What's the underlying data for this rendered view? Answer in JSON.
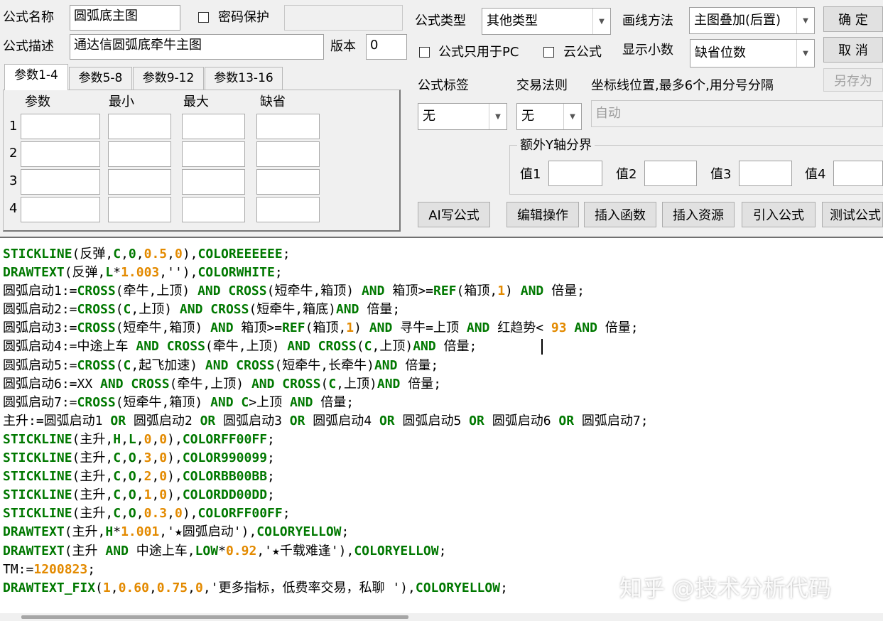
{
  "formula": {
    "name_label": "公式名称",
    "name_value": "圆弧底主图",
    "password_label": "密码保护",
    "password_value": "",
    "desc_label": "公式描述",
    "desc_value": "通达信圆弧底牵牛主图",
    "version_label": "版本",
    "version_value": "0",
    "type_label": "公式类型",
    "type_value": "其他类型",
    "draw_label": "画线方法",
    "draw_value": "主图叠加(后置)",
    "pc_only_label": "公式只用于PC",
    "cloud_label": "云公式",
    "decimals_label": "显示小数",
    "decimals_value": "缺省位数"
  },
  "buttons": {
    "ok": "确  定",
    "cancel": "取  消",
    "save_as": "另存为",
    "ai": "AI写公式",
    "edit": "编辑操作",
    "insert_func": "插入函数",
    "insert_res": "插入资源",
    "import": "引入公式",
    "test": "测试公式"
  },
  "params": {
    "tabs": [
      "参数1-4",
      "参数5-8",
      "参数9-12",
      "参数13-16"
    ],
    "headers": [
      "参数",
      "最小",
      "最大",
      "缺省"
    ],
    "rows": [
      "1",
      "2",
      "3",
      "4"
    ]
  },
  "tags": {
    "tag_label": "公式标签",
    "tag_value": "无",
    "trade_label": "交易法则",
    "trade_value": "无",
    "axis_label": "坐标线位置,最多6个,用分号分隔",
    "axis_value": "自动",
    "yaxis_group": "额外Y轴分界",
    "values": [
      "值1",
      "值2",
      "值3",
      "值4"
    ]
  },
  "code_lines": [
    [
      [
        "k",
        "STICKLINE"
      ],
      [
        "t",
        "(反弹,"
      ],
      [
        "k",
        "C"
      ],
      [
        "t",
        ","
      ],
      [
        "k",
        "0"
      ],
      [
        "t",
        ","
      ],
      [
        "n",
        "0.5"
      ],
      [
        "t",
        ","
      ],
      [
        "n",
        "0"
      ],
      [
        "t",
        "),"
      ],
      [
        "k",
        "COLOREEEEEE"
      ],
      [
        "t",
        ";"
      ]
    ],
    [
      [
        "k",
        "DRAWTEXT"
      ],
      [
        "t",
        "(反弹,"
      ],
      [
        "k",
        "L"
      ],
      [
        "t",
        "*"
      ],
      [
        "n",
        "1.003"
      ],
      [
        "t",
        ",''),"
      ],
      [
        "k",
        "COLORWHITE"
      ],
      [
        "t",
        ";"
      ]
    ],
    [
      [
        "t",
        "圆弧启动1:="
      ],
      [
        "k",
        "CROSS"
      ],
      [
        "t",
        "(牵牛,上顶) "
      ],
      [
        "k",
        "AND"
      ],
      [
        "t",
        " "
      ],
      [
        "k",
        "CROSS"
      ],
      [
        "t",
        "(短牵牛,箱顶) "
      ],
      [
        "k",
        "AND"
      ],
      [
        "t",
        " 箱顶>="
      ],
      [
        "k",
        "REF"
      ],
      [
        "t",
        "(箱顶,"
      ],
      [
        "n",
        "1"
      ],
      [
        "t",
        ") "
      ],
      [
        "k",
        "AND"
      ],
      [
        "t",
        " 倍量;"
      ]
    ],
    [
      [
        "t",
        "圆弧启动2:="
      ],
      [
        "k",
        "CROSS"
      ],
      [
        "t",
        "("
      ],
      [
        "k",
        "C"
      ],
      [
        "t",
        ",上顶) "
      ],
      [
        "k",
        "AND"
      ],
      [
        "t",
        " "
      ],
      [
        "k",
        "CROSS"
      ],
      [
        "t",
        "(短牵牛,箱底)"
      ],
      [
        "k",
        "AND"
      ],
      [
        "t",
        " 倍量;"
      ]
    ],
    [
      [
        "t",
        "圆弧启动3:="
      ],
      [
        "k",
        "CROSS"
      ],
      [
        "t",
        "(短牵牛,箱顶) "
      ],
      [
        "k",
        "AND"
      ],
      [
        "t",
        " 箱顶>="
      ],
      [
        "k",
        "REF"
      ],
      [
        "t",
        "(箱顶,"
      ],
      [
        "n",
        "1"
      ],
      [
        "t",
        ") "
      ],
      [
        "k",
        "AND"
      ],
      [
        "t",
        " 寻牛=上顶 "
      ],
      [
        "k",
        "AND"
      ],
      [
        "t",
        " 红趋势< "
      ],
      [
        "n",
        "93"
      ],
      [
        "t",
        " "
      ],
      [
        "k",
        "AND"
      ],
      [
        "t",
        " 倍量;"
      ]
    ],
    [
      [
        "t",
        "圆弧启动4:=中途上车 "
      ],
      [
        "k",
        "AND"
      ],
      [
        "t",
        " "
      ],
      [
        "k",
        "CROSS"
      ],
      [
        "t",
        "(牵牛,上顶) "
      ],
      [
        "k",
        "AND"
      ],
      [
        "t",
        " "
      ],
      [
        "k",
        "CROSS"
      ],
      [
        "t",
        "("
      ],
      [
        "k",
        "C"
      ],
      [
        "t",
        ",上顶)"
      ],
      [
        "k",
        "AND"
      ],
      [
        "t",
        " 倍量;"
      ]
    ],
    [
      [
        "t",
        "圆弧启动5:="
      ],
      [
        "k",
        "CROSS"
      ],
      [
        "t",
        "("
      ],
      [
        "k",
        "C"
      ],
      [
        "t",
        ",起飞加速) "
      ],
      [
        "k",
        "AND"
      ],
      [
        "t",
        " "
      ],
      [
        "k",
        "CROSS"
      ],
      [
        "t",
        "(短牵牛,长牵牛)"
      ],
      [
        "k",
        "AND"
      ],
      [
        "t",
        " 倍量;"
      ]
    ],
    [
      [
        "t",
        "圆弧启动6:=XX "
      ],
      [
        "k",
        "AND"
      ],
      [
        "t",
        " "
      ],
      [
        "k",
        "CROSS"
      ],
      [
        "t",
        "(牵牛,上顶) "
      ],
      [
        "k",
        "AND"
      ],
      [
        "t",
        " "
      ],
      [
        "k",
        "CROSS"
      ],
      [
        "t",
        "("
      ],
      [
        "k",
        "C"
      ],
      [
        "t",
        ",上顶)"
      ],
      [
        "k",
        "AND"
      ],
      [
        "t",
        " 倍量;"
      ]
    ],
    [
      [
        "t",
        "圆弧启动7:="
      ],
      [
        "k",
        "CROSS"
      ],
      [
        "t",
        "(短牵牛,箱顶) "
      ],
      [
        "k",
        "AND"
      ],
      [
        "t",
        " "
      ],
      [
        "k",
        "C"
      ],
      [
        "t",
        ">上顶 "
      ],
      [
        "k",
        "AND"
      ],
      [
        "t",
        " 倍量;"
      ]
    ],
    [
      [
        "t",
        "主升:=圆弧启动1 "
      ],
      [
        "k",
        "OR"
      ],
      [
        "t",
        " 圆弧启动2 "
      ],
      [
        "k",
        "OR"
      ],
      [
        "t",
        " 圆弧启动3 "
      ],
      [
        "k",
        "OR"
      ],
      [
        "t",
        " 圆弧启动4 "
      ],
      [
        "k",
        "OR"
      ],
      [
        "t",
        " 圆弧启动5 "
      ],
      [
        "k",
        "OR"
      ],
      [
        "t",
        " 圆弧启动6 "
      ],
      [
        "k",
        "OR"
      ],
      [
        "t",
        " 圆弧启动7;"
      ]
    ],
    [
      [
        "k",
        "STICKLINE"
      ],
      [
        "t",
        "(主升,"
      ],
      [
        "k",
        "H"
      ],
      [
        "t",
        ","
      ],
      [
        "k",
        "L"
      ],
      [
        "t",
        ","
      ],
      [
        "n",
        "0"
      ],
      [
        "t",
        ","
      ],
      [
        "n",
        "0"
      ],
      [
        "t",
        "),"
      ],
      [
        "k",
        "COLORFF00FF"
      ],
      [
        "t",
        ";"
      ]
    ],
    [
      [
        "k",
        "STICKLINE"
      ],
      [
        "t",
        "(主升,"
      ],
      [
        "k",
        "C"
      ],
      [
        "t",
        ","
      ],
      [
        "k",
        "O"
      ],
      [
        "t",
        ","
      ],
      [
        "n",
        "3"
      ],
      [
        "t",
        ","
      ],
      [
        "n",
        "0"
      ],
      [
        "t",
        "),"
      ],
      [
        "k",
        "COLOR990099"
      ],
      [
        "t",
        ";"
      ]
    ],
    [
      [
        "k",
        "STICKLINE"
      ],
      [
        "t",
        "(主升,"
      ],
      [
        "k",
        "C"
      ],
      [
        "t",
        ","
      ],
      [
        "k",
        "O"
      ],
      [
        "t",
        ","
      ],
      [
        "n",
        "2"
      ],
      [
        "t",
        ","
      ],
      [
        "n",
        "0"
      ],
      [
        "t",
        "),"
      ],
      [
        "k",
        "COLORBB00BB"
      ],
      [
        "t",
        ";"
      ]
    ],
    [
      [
        "k",
        "STICKLINE"
      ],
      [
        "t",
        "(主升,"
      ],
      [
        "k",
        "C"
      ],
      [
        "t",
        ","
      ],
      [
        "k",
        "O"
      ],
      [
        "t",
        ","
      ],
      [
        "n",
        "1"
      ],
      [
        "t",
        ","
      ],
      [
        "n",
        "0"
      ],
      [
        "t",
        "),"
      ],
      [
        "k",
        "COLORDD00DD"
      ],
      [
        "t",
        ";"
      ]
    ],
    [
      [
        "k",
        "STICKLINE"
      ],
      [
        "t",
        "(主升,"
      ],
      [
        "k",
        "C"
      ],
      [
        "t",
        ","
      ],
      [
        "k",
        "O"
      ],
      [
        "t",
        ","
      ],
      [
        "n",
        "0.3"
      ],
      [
        "t",
        ","
      ],
      [
        "n",
        "0"
      ],
      [
        "t",
        "),"
      ],
      [
        "k",
        "COLORFF00FF"
      ],
      [
        "t",
        ";"
      ]
    ],
    [
      [
        "k",
        "DRAWTEXT"
      ],
      [
        "t",
        "(主升,"
      ],
      [
        "k",
        "H"
      ],
      [
        "t",
        "*"
      ],
      [
        "n",
        "1.001"
      ],
      [
        "t",
        ",'★圆弧启动'),"
      ],
      [
        "k",
        "COLORYELLOW"
      ],
      [
        "t",
        ";"
      ]
    ],
    [
      [
        "k",
        "DRAWTEXT"
      ],
      [
        "t",
        "(主升 "
      ],
      [
        "k",
        "AND"
      ],
      [
        "t",
        " 中途上车,"
      ],
      [
        "k",
        "LOW"
      ],
      [
        "t",
        "*"
      ],
      [
        "n",
        "0.92"
      ],
      [
        "t",
        ",'★千载难逢'),"
      ],
      [
        "k",
        "COLORYELLOW"
      ],
      [
        "t",
        ";"
      ]
    ],
    [
      [
        "t",
        "TM:="
      ],
      [
        "n",
        "1200823"
      ],
      [
        "t",
        ";"
      ]
    ],
    [
      [
        "k",
        "DRAWTEXT_FIX"
      ],
      [
        "t",
        "("
      ],
      [
        "n",
        "1"
      ],
      [
        "t",
        ","
      ],
      [
        "n",
        "0.60"
      ],
      [
        "t",
        ","
      ],
      [
        "n",
        "0.75"
      ],
      [
        "t",
        ","
      ],
      [
        "n",
        "0"
      ],
      [
        "t",
        ",'更多指标，低费率交易，私聊 '),"
      ],
      [
        "k",
        "COLORYELLOW"
      ],
      [
        "t",
        ";"
      ]
    ]
  ],
  "watermark": "知乎 @技术分析代码"
}
